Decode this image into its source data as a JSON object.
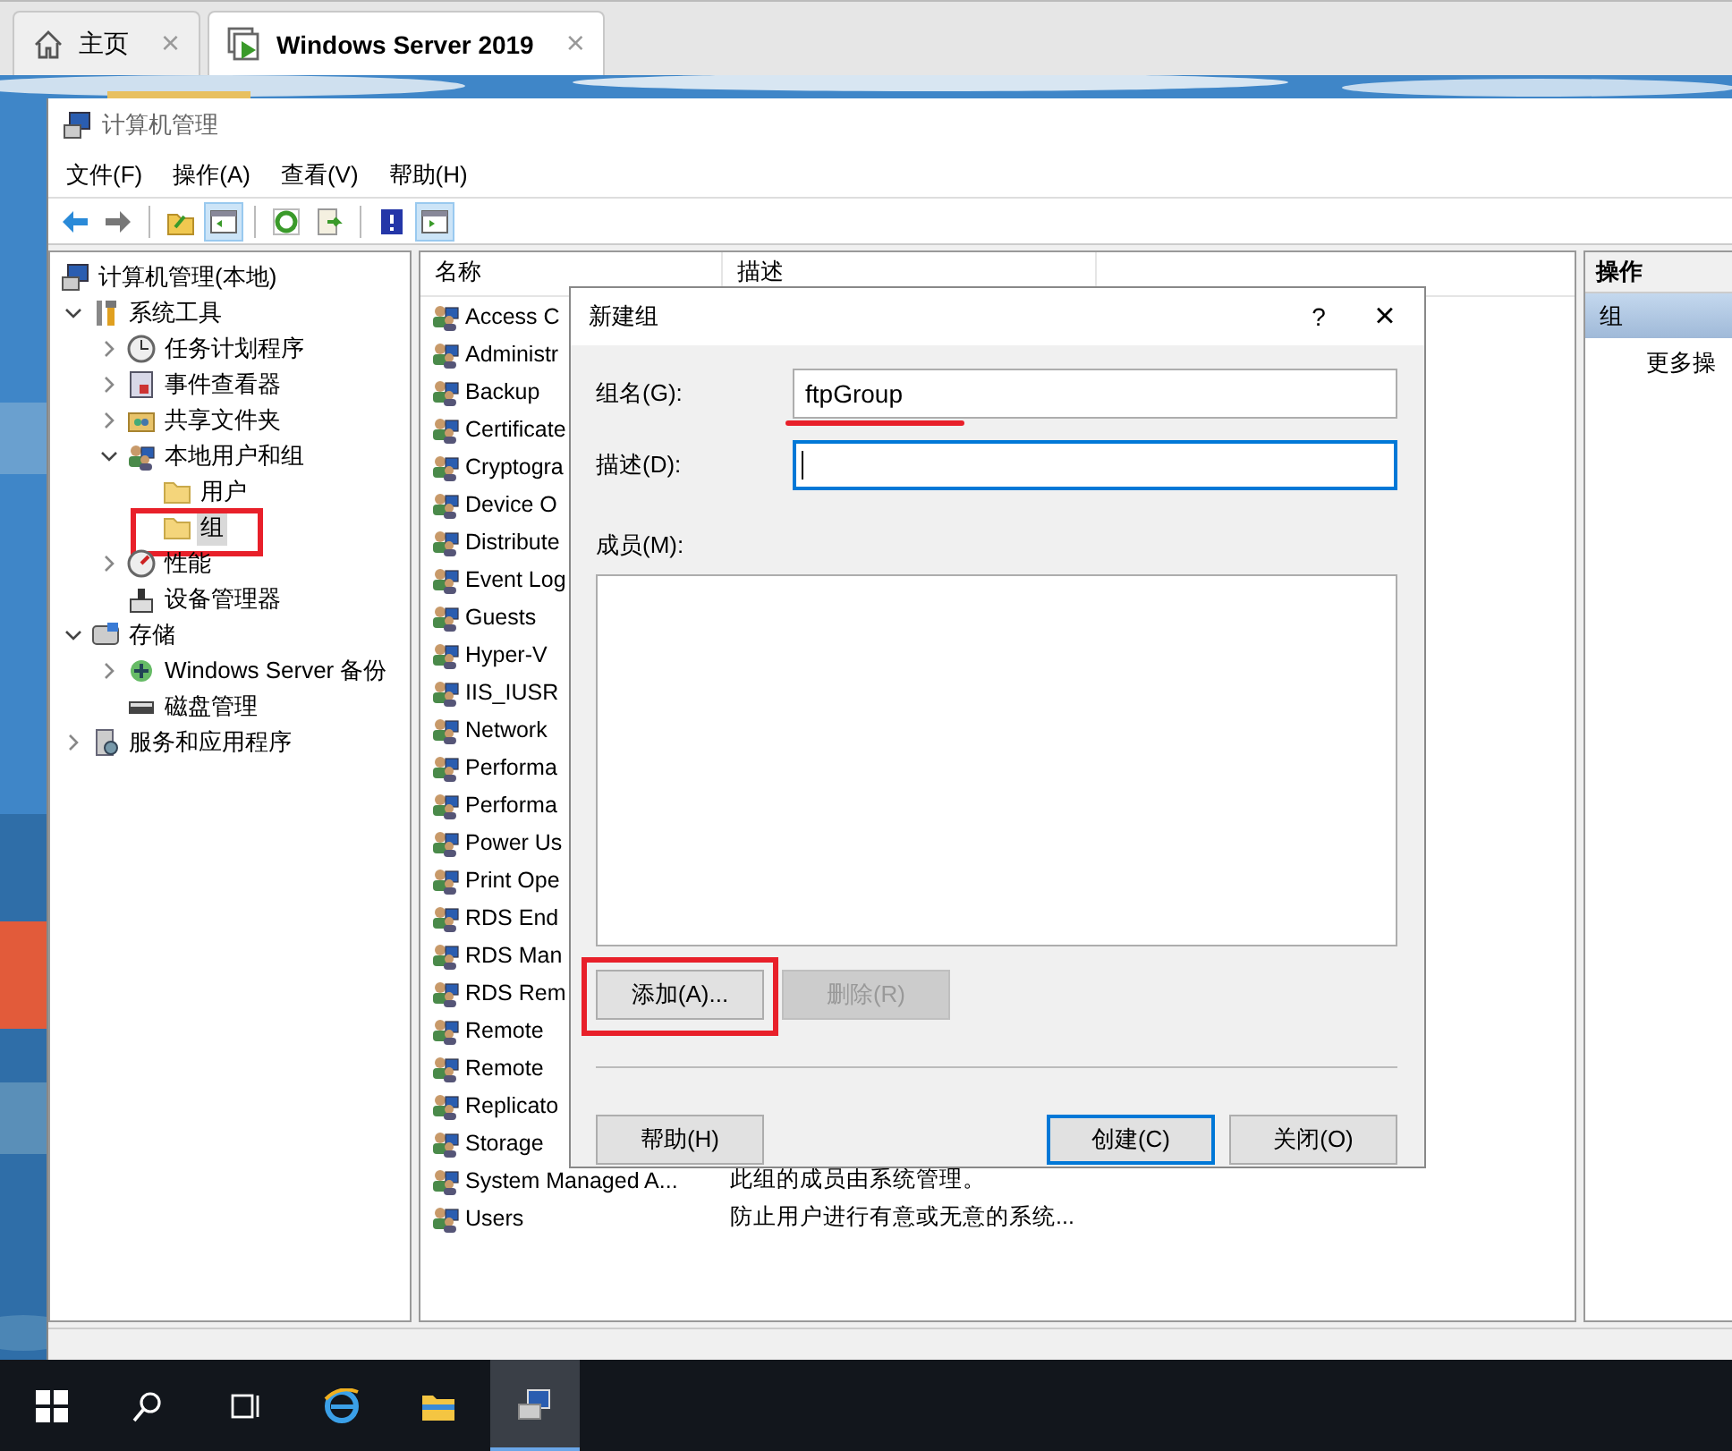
{
  "browser_tabs": [
    {
      "label": "主页",
      "close": "×",
      "selected": false
    },
    {
      "label": "Windows Server 2019",
      "close": "×",
      "selected": true
    }
  ],
  "window": {
    "title": "计算机管理"
  },
  "menu": [
    "文件(F)",
    "操作(A)",
    "查看(V)",
    "帮助(H)"
  ],
  "toolbar": [
    {
      "pressed": false
    },
    {
      "pressed": false
    },
    {
      "pressed": false
    },
    {
      "pressed": true
    },
    {
      "pressed": false
    },
    {
      "pressed": false
    },
    {
      "pressed": false
    },
    {
      "pressed": true
    }
  ],
  "tree": [
    {
      "label": "计算机管理(本地)",
      "selected": false,
      "children": [
        {
          "label": "系统工具",
          "selected": false,
          "expanded": true,
          "children": [
            {
              "label": "任务计划程序",
              "selected": false,
              "expanded": false
            },
            {
              "label": "事件查看器",
              "selected": false,
              "expanded": false
            },
            {
              "label": "共享文件夹",
              "selected": false,
              "expanded": false
            },
            {
              "label": "本地用户和组",
              "selected": false,
              "expanded": true,
              "children": [
                {
                  "label": "用户",
                  "selected": false
                },
                {
                  "label": "组",
                  "selected": true,
                  "annotated": true
                }
              ]
            },
            {
              "label": "性能",
              "selected": false,
              "expanded": false
            },
            {
              "label": "设备管理器",
              "selected": false
            }
          ]
        },
        {
          "label": "存储",
          "selected": false,
          "expanded": true,
          "children": [
            {
              "label": "Windows Server 备份",
              "selected": false,
              "expanded": false
            },
            {
              "label": "磁盘管理",
              "selected": false
            }
          ]
        },
        {
          "label": "服务和应用程序",
          "selected": false,
          "expanded": false
        }
      ]
    }
  ],
  "table": {
    "columns": [
      "名称",
      "描述"
    ],
    "rows": [
      {
        "name": "Access C"
      },
      {
        "name": "Administr"
      },
      {
        "name": "Backup"
      },
      {
        "name": "Certificate"
      },
      {
        "name": "Cryptogra"
      },
      {
        "name": "Device O"
      },
      {
        "name": "Distribute"
      },
      {
        "name": "Event Log"
      },
      {
        "name": "Guests"
      },
      {
        "name": "Hyper-V"
      },
      {
        "name": "IIS_IUSR"
      },
      {
        "name": "Network"
      },
      {
        "name": "Performa"
      },
      {
        "name": "Performa"
      },
      {
        "name": "Power Us"
      },
      {
        "name": "Print Ope"
      },
      {
        "name": "RDS End"
      },
      {
        "name": "RDS Man"
      },
      {
        "name": "RDS Rem"
      },
      {
        "name": "Remote"
      },
      {
        "name": "Remote"
      },
      {
        "name": "Replicato"
      },
      {
        "name": "Storage"
      },
      {
        "name": "System Managed A...",
        "description": "此组的成员由系统管理。"
      },
      {
        "name": "Users",
        "description": "防止用户进行有意或无意的系统..."
      }
    ]
  },
  "actions": {
    "header": "操作",
    "section": "组",
    "items": [
      "更多操"
    ]
  },
  "dialog": {
    "title": "新建组",
    "help": "?",
    "close": "×",
    "fields": [
      {
        "label": "组名(G):",
        "value": "ftpGroup",
        "focused": false,
        "annotated": true
      },
      {
        "label": "描述(D):",
        "focused": true
      }
    ],
    "members_label": "成员(M):",
    "member_buttons": [
      {
        "label": "添加(A)...",
        "disabled": false,
        "annotated": true
      },
      {
        "label": "删除(R)",
        "disabled": true
      }
    ],
    "footer_buttons": [
      {
        "label": "帮助(H)",
        "default": false
      },
      {
        "label": "创建(C)",
        "default": true
      },
      {
        "label": "关闭(O)",
        "default": false
      }
    ]
  },
  "taskbar": [
    {
      "active": false
    },
    {
      "active": false
    },
    {
      "active": false
    },
    {
      "active": false
    },
    {
      "active": false
    },
    {
      "active": true
    }
  ]
}
